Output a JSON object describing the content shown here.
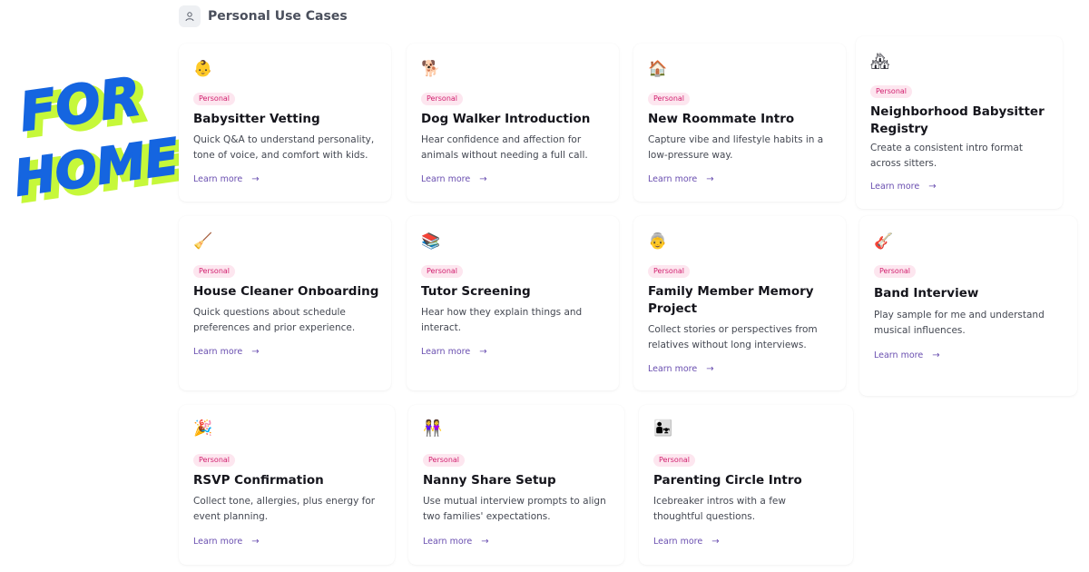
{
  "header": {
    "title": "Personal Use Cases",
    "icon": "user-icon"
  },
  "logo": {
    "line1": "FOR",
    "line2": "HOME",
    "primary_color": "#1565e0",
    "shadow_color": "#c6f83a"
  },
  "badge_color": "#d11f6e",
  "cards": [
    {
      "emoji": "👶",
      "icon": "baby-icon",
      "badge": "Personal",
      "title": "Babysitter Vetting",
      "desc": "Quick Q&A to understand personality, tone of voice, and comfort with kids.",
      "learn": "Learn more"
    },
    {
      "emoji": "🐕",
      "icon": "dog-icon",
      "badge": "Personal",
      "title": "Dog Walker Introduction",
      "desc": "Hear confidence and affection for animals without needing a full call.",
      "learn": "Learn more"
    },
    {
      "emoji": "🏠",
      "icon": "house-icon",
      "badge": "Personal",
      "title": "New Roommate Intro",
      "desc": "Capture vibe and lifestyle habits in a low-pressure way.",
      "learn": "Learn more"
    },
    {
      "emoji": "🏘",
      "icon": "houses-icon",
      "badge": "Personal",
      "title": "Neighborhood Babysitter Registry",
      "desc": "Create a consistent intro format across sitters.",
      "learn": "Learn more"
    },
    {
      "emoji": "🧹",
      "icon": "broom-icon",
      "badge": "Personal",
      "title": "House Cleaner Onboarding",
      "desc": "Quick questions about schedule preferences and prior experience.",
      "learn": "Learn more"
    },
    {
      "emoji": "📚",
      "icon": "books-icon",
      "badge": "Personal",
      "title": "Tutor Screening",
      "desc": "Hear how they explain things and interact.",
      "learn": "Learn more"
    },
    {
      "emoji": "👵",
      "icon": "grandma-icon",
      "badge": "Personal",
      "title": "Family Member Memory Project",
      "desc": "Collect stories or perspectives from relatives without long interviews.",
      "learn": "Learn more"
    },
    {
      "emoji": "🎸",
      "icon": "guitar-icon",
      "badge": "Personal",
      "title": "Band Interview",
      "desc": "Play sample for me and understand musical influences.",
      "learn": "Learn more"
    },
    {
      "emoji": "🎉",
      "icon": "party-popper-icon",
      "badge": "Personal",
      "title": "RSVP Confirmation",
      "desc": "Collect tone, allergies, plus energy for event planning.",
      "learn": "Learn more"
    },
    {
      "emoji": "👭",
      "icon": "two-people-icon",
      "badge": "Personal",
      "title": "Nanny Share Setup",
      "desc": "Use mutual interview prompts to align two families' expectations.",
      "learn": "Learn more"
    },
    {
      "emoji": "👨‍👧",
      "icon": "parent-child-icon",
      "badge": "Personal",
      "title": "Parenting Circle Intro",
      "desc": "Icebreaker intros with a few thoughtful questions.",
      "learn": "Learn more"
    }
  ]
}
